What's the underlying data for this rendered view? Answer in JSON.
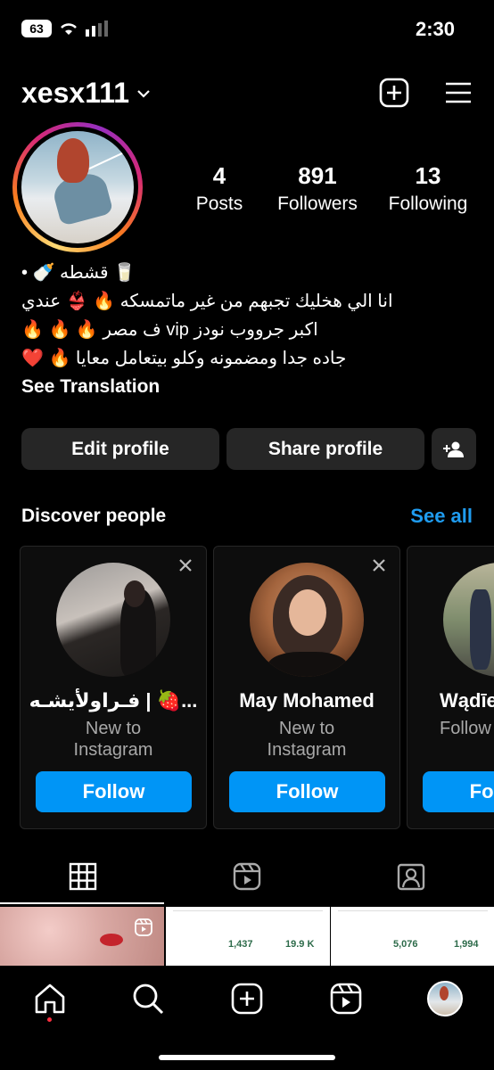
{
  "status_bar": {
    "battery": "63",
    "time": "2:30"
  },
  "header": {
    "username": "xesx111"
  },
  "profile": {
    "stats": [
      {
        "num": "4",
        "label": "Posts"
      },
      {
        "num": "891",
        "label": "Followers"
      },
      {
        "num": "13",
        "label": "Following"
      }
    ],
    "bio": [
      "🥛 قشطه 🍼 •",
      "انا الي هخليك تجبهم من غير ماتمسكه 🔥 👙 عندي",
      "اكبر جرووب نودز vip ف مصر 🔥 🔥 🔥",
      "جاده جدا ومضمونه وكلو بيتعامل معايا 🔥 ❤️"
    ],
    "see_translation": "See Translation"
  },
  "buttons": {
    "edit": "Edit profile",
    "share": "Share profile"
  },
  "discover": {
    "title": "Discover people",
    "see_all": "See all",
    "cards": [
      {
        "name": "فـراولأيشـه | 🍓...",
        "sub": "New to Instagram",
        "follow": "Follow"
      },
      {
        "name": "May Mohamed",
        "sub": "New to Instagram",
        "follow": "Follow"
      },
      {
        "name": "Wądīe",
        "sub": "Follow",
        "follow": "Follow"
      }
    ]
  },
  "grid": {
    "post2": {
      "v1": "1,437",
      "v2": "19.9 K"
    },
    "post3": {
      "v1": "5,076",
      "v2": "1,994"
    }
  },
  "colors": {
    "accent": "#0095f6",
    "link": "#1f9cf0",
    "button_bg": "#262626"
  }
}
